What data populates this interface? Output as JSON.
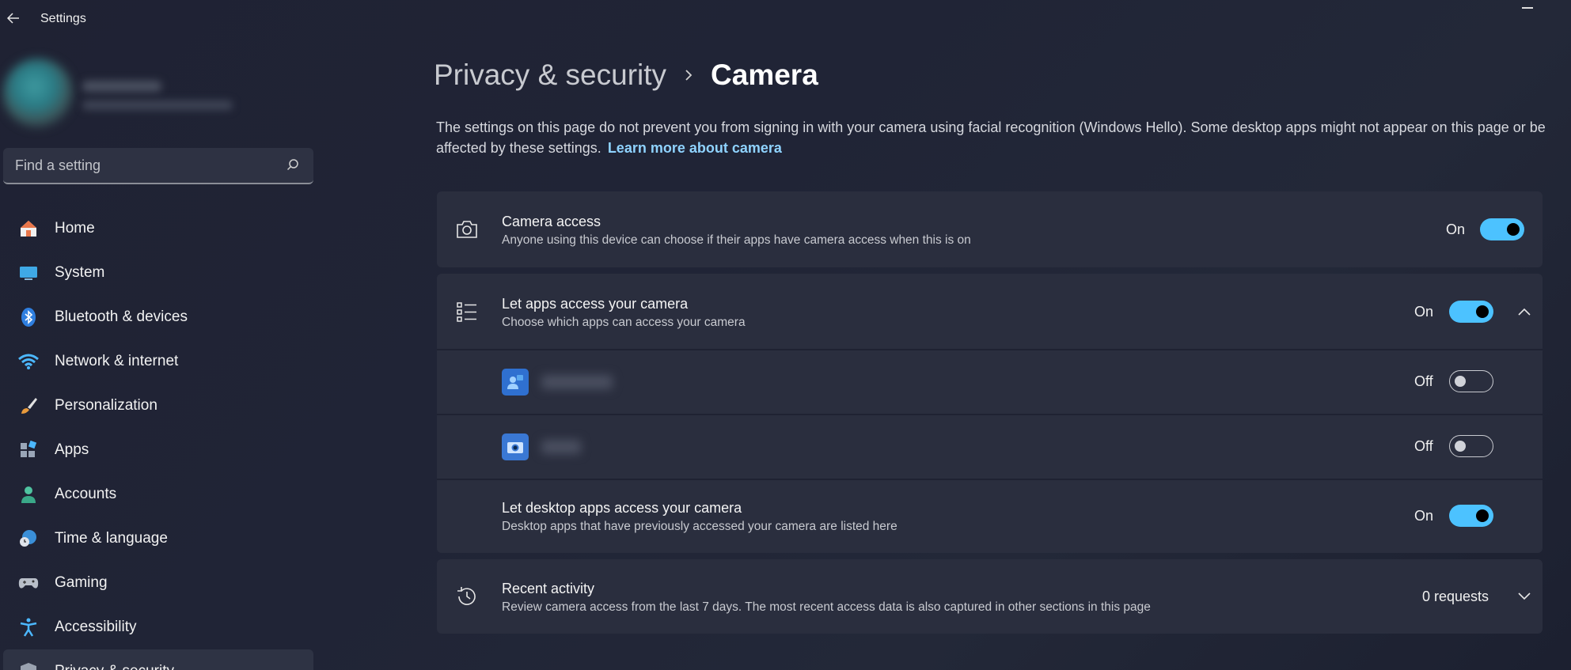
{
  "window": {
    "title": "Settings"
  },
  "sidebar": {
    "search_placeholder": "Find a setting",
    "items": [
      {
        "label": "Home",
        "icon": "home-icon"
      },
      {
        "label": "System",
        "icon": "system-icon"
      },
      {
        "label": "Bluetooth & devices",
        "icon": "bluetooth-icon"
      },
      {
        "label": "Network & internet",
        "icon": "wifi-icon"
      },
      {
        "label": "Personalization",
        "icon": "brush-icon"
      },
      {
        "label": "Apps",
        "icon": "apps-icon"
      },
      {
        "label": "Accounts",
        "icon": "accounts-icon"
      },
      {
        "label": "Time & language",
        "icon": "globe-clock-icon"
      },
      {
        "label": "Gaming",
        "icon": "gamepad-icon"
      },
      {
        "label": "Accessibility",
        "icon": "accessibility-icon"
      },
      {
        "label": "Privacy & security",
        "icon": "shield-icon",
        "selected": true
      }
    ]
  },
  "breadcrumb": {
    "parent": "Privacy & security",
    "current": "Camera"
  },
  "description": {
    "text": "The settings on this page do not prevent you from signing in with your camera using facial recognition (Windows Hello). Some desktop apps might not appear on this page or be affected by these settings.",
    "link": "Learn more about camera"
  },
  "camera_access": {
    "title": "Camera access",
    "subtitle": "Anyone using this device can choose if their apps have camera access when this is on",
    "state": "On",
    "icon": "camera-icon"
  },
  "let_apps": {
    "title": "Let apps access your camera",
    "subtitle": "Choose which apps can access your camera",
    "state": "On",
    "icon": "list-icon"
  },
  "apps": [
    {
      "state": "Off",
      "icon": "people-app-icon"
    },
    {
      "state": "Off",
      "icon": "camera-app-icon"
    }
  ],
  "desktop_apps": {
    "title": "Let desktop apps access your camera",
    "subtitle": "Desktop apps that have previously accessed your camera are listed here",
    "state": "On"
  },
  "recent_activity": {
    "title": "Recent activity",
    "subtitle": "Review camera access from the last 7 days. The most recent access data is also captured in other sections in this page",
    "value": "0 requests",
    "icon": "history-icon"
  },
  "colors": {
    "accent": "#4cc2ff",
    "link": "#8fd3ff",
    "card": "#2a2e3e",
    "background": "#202334"
  }
}
